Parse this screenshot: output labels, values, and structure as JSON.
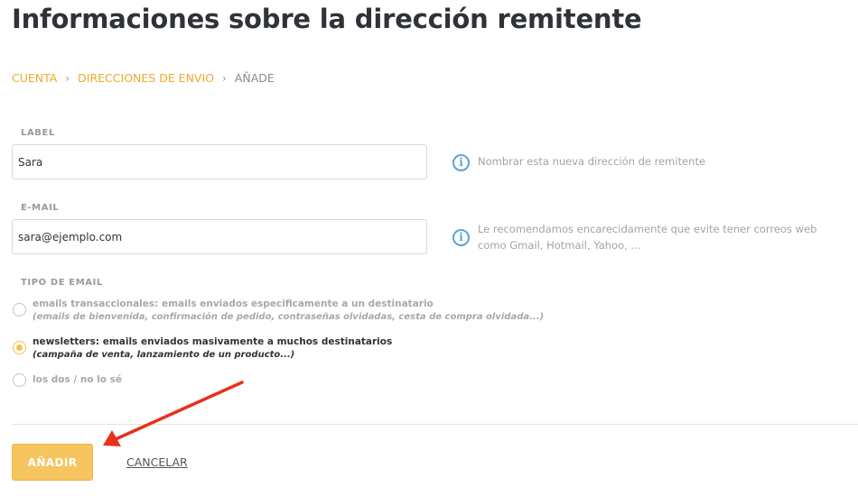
{
  "page": {
    "title": "Informaciones sobre la dirección remitente"
  },
  "breadcrumb": {
    "items": [
      {
        "label": "CUENTA"
      },
      {
        "label": "DIRECCIONES DE ENVIO"
      },
      {
        "label": "AÑADE"
      }
    ],
    "separator": "›"
  },
  "form": {
    "label_field": {
      "label": "LABEL",
      "value": "Sara",
      "help": "Nombrar esta nueva dirección de remitente"
    },
    "email_field": {
      "label": "E-MAIL",
      "value": "sara@ejemplo.com",
      "help": "Le recomendamos encarecidamente que evite tener correos web como Gmail, Hotmail, Yahoo, ..."
    },
    "email_type": {
      "label": "TIPO DE EMAIL",
      "options": [
        {
          "title": "emails transaccionales: emails enviados especificamente a un destinatario",
          "subtitle": "(emails de bienvenida, confirmación de pedido, contraseñas olvidadas, cesta de compra olvidada...)",
          "selected": false
        },
        {
          "title": "newsletters: emails enviados masivamente a muchos destinatarios",
          "subtitle": "(campaña de venta, lanzamiento de un producto...)",
          "selected": true
        },
        {
          "title": "los dos / no lo sé",
          "subtitle": "",
          "selected": false
        }
      ]
    }
  },
  "actions": {
    "add_label": "AÑADIR",
    "cancel_label": "CANCELAR"
  },
  "colors": {
    "accent": "#f6c55f",
    "breadcrumb_link": "#f0a92e",
    "info": "#5aa5d6",
    "annotation_arrow": "#e8301c"
  },
  "icons": {
    "info": "info-icon",
    "chevron": "chevron-right-icon",
    "annotation": "annotation-arrow-icon"
  }
}
